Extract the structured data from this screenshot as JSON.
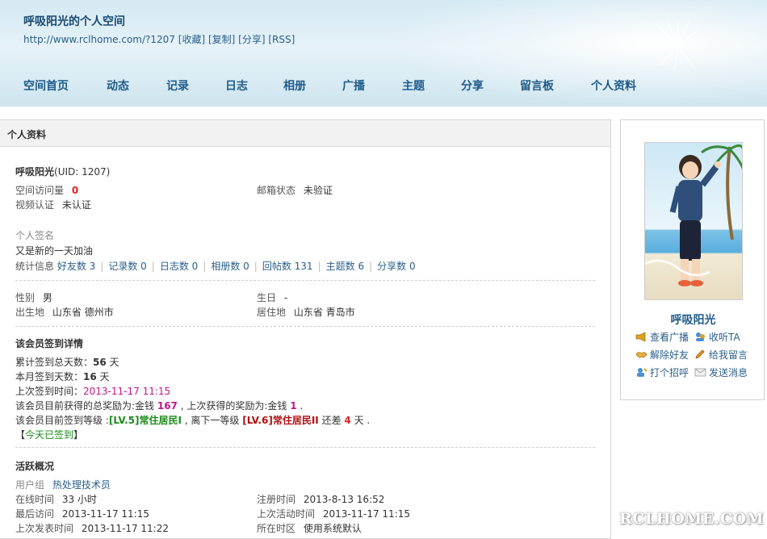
{
  "header": {
    "title": "呼吸阳光的个人空间",
    "url": "http://www.rclhome.com/?1207",
    "links": [
      "[收藏]",
      "[复制]",
      "[分享]",
      "[RSS]"
    ]
  },
  "nav": [
    "空间首页",
    "动态",
    "记录",
    "日志",
    "相册",
    "广播",
    "主题",
    "分享",
    "留言板",
    "个人资料"
  ],
  "profile": {
    "panel_title": "个人资料",
    "name": "呼吸阳光",
    "uid": "(UID: 1207)",
    "visits_label": "空间访问量",
    "visits_value": "0",
    "email_label": "邮箱状态",
    "email_value": "未验证",
    "video_label": "视频认证",
    "video_value": "未认证",
    "signature_label": "个人签名",
    "signature_value": "又是新的一天加油",
    "stats_label": "统计信息",
    "stats": [
      "好友数 3",
      "记录数 0",
      "日志数 0",
      "相册数 0",
      "回帖数 131",
      "主题数 6",
      "分享数 0"
    ],
    "gender_label": "性别",
    "gender_value": "男",
    "birthday_label": "生日",
    "birthday_value": "-",
    "birthplace_label": "出生地",
    "birthplace_value": "山东省 德州市",
    "residence_label": "居住地",
    "residence_value": "山东省 青岛市"
  },
  "signin": {
    "title": "该会员签到详情",
    "total_prefix": "累计签到总天数：",
    "total_value": "56",
    "total_suffix": " 天",
    "month_prefix": "本月签到天数：",
    "month_value": "16",
    "month_suffix": " 天",
    "last_prefix": "上次签到时间：",
    "last_value": "2013-11-17 11:15",
    "reward_prefix": "该会员目前获得的总奖励为:金钱 ",
    "reward_total": "167",
    "reward_mid": " , 上次获得的奖励为:金钱 ",
    "reward_last": "1",
    "reward_suffix": " .",
    "level_prefix": "该会员目前签到等级 :",
    "level_current": "[LV.5]常住居民I",
    "level_mid": " , 离下一等级 ",
    "level_next": "[LV.6]常住居民II",
    "level_mid2": " 还差 ",
    "level_diff": "4",
    "level_suffix": " 天 .",
    "today_open": "【",
    "today": "今天已签到",
    "today_close": "】"
  },
  "activity": {
    "title": "活跃概况",
    "group_label": "用户组",
    "group_value": "热处理技术员",
    "online_label": "在线时间",
    "online_value": "33 小时",
    "register_label": "注册时间",
    "register_value": "2013-8-13 16:52",
    "last_visit_label": "最后访问",
    "last_visit_value": "2013-11-17 11:15",
    "last_active_label": "上次活动时间",
    "last_active_value": "2013-11-17 11:15",
    "last_post_label": "上次发表时间",
    "last_post_value": "2013-11-17 11:22",
    "timezone_label": "所在时区",
    "timezone_value": "使用系统默认"
  },
  "sidebar": {
    "name": "呼吸阳光",
    "actions": [
      "查看广播",
      "收听TA",
      "解除好友",
      "给我留言",
      "打个招呼",
      "发送消息"
    ]
  },
  "watermark": "RCLHOME.COM",
  "colors": {
    "link": "#2b5f8a",
    "nav": "#1e5b8a",
    "accent_red": "#e02020",
    "accent_pink": "#c0168a",
    "level_green": "#1a8a1a"
  }
}
